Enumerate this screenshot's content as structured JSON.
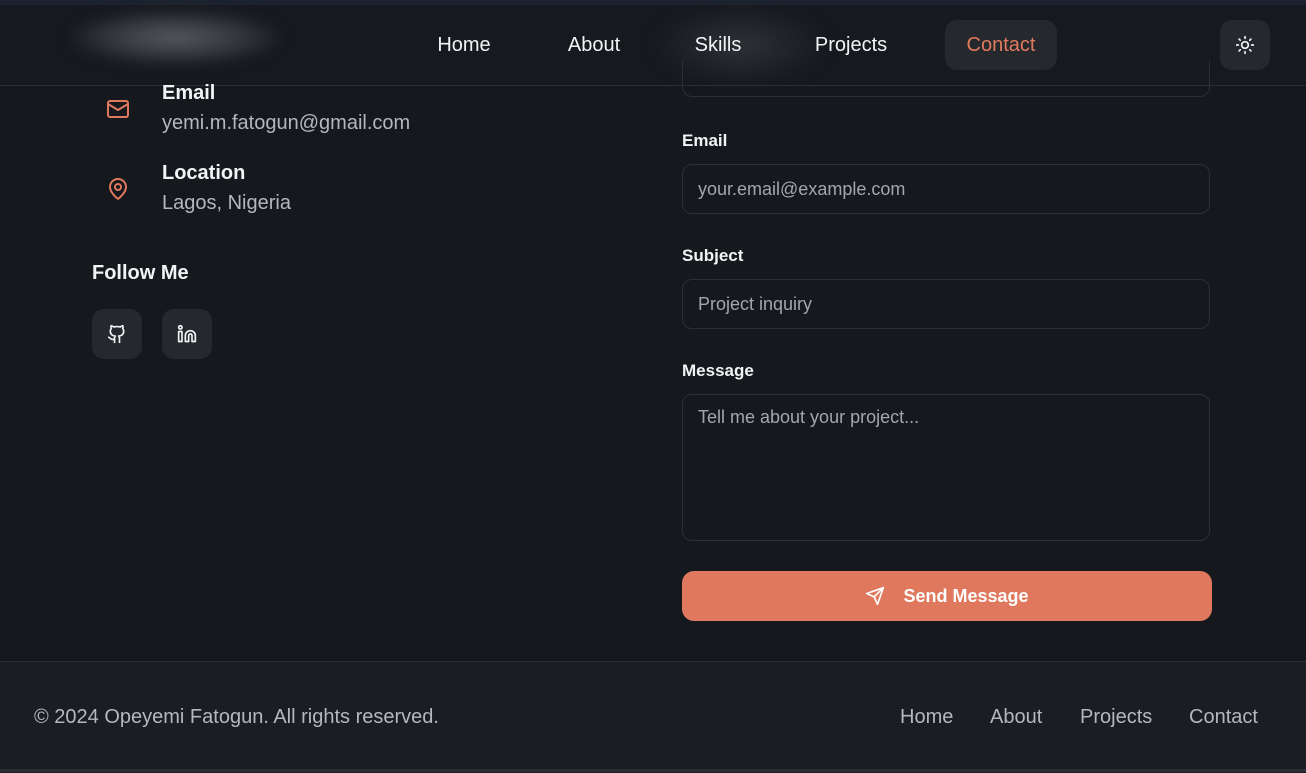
{
  "nav": {
    "links": [
      "Home",
      "About",
      "Skills",
      "Projects",
      "Contact"
    ],
    "active": "Contact"
  },
  "contact_info": {
    "email": {
      "label": "Email",
      "value": "yemi.m.fatogun@gmail.com"
    },
    "location": {
      "label": "Location",
      "value": "Lagos, Nigeria"
    }
  },
  "follow": {
    "title": "Follow Me",
    "icons": [
      "github-icon",
      "linkedin-icon"
    ]
  },
  "form": {
    "email_label": "Email",
    "email_placeholder": "your.email@example.com",
    "subject_label": "Subject",
    "subject_placeholder": "Project inquiry",
    "message_label": "Message",
    "message_placeholder": "Tell me about your project...",
    "submit_label": "Send Message"
  },
  "footer": {
    "copyright": "© 2024 Opeyemi Fatogun. All rights reserved.",
    "links": [
      "Home",
      "About",
      "Projects",
      "Contact"
    ]
  },
  "colors": {
    "accent": "#e07a5f",
    "background": "#15181d",
    "surface": "#25282d"
  }
}
